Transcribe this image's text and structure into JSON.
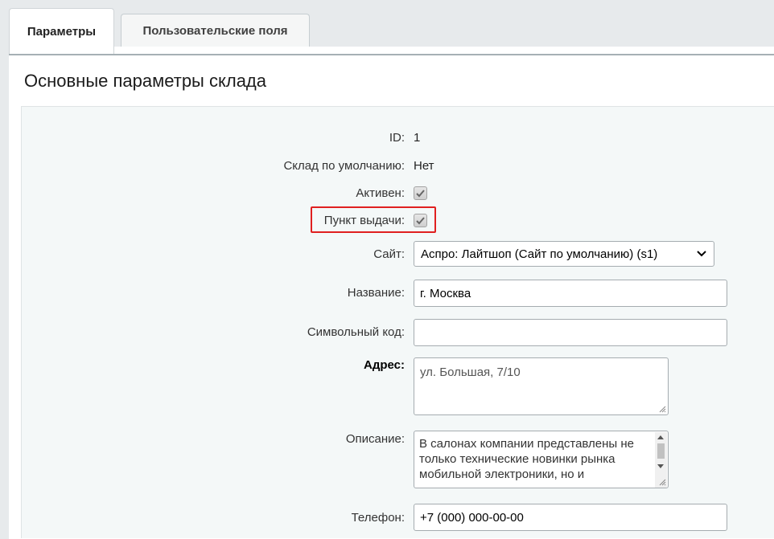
{
  "tabs": [
    {
      "label": "Параметры",
      "active": true
    },
    {
      "label": "Пользовательские поля",
      "active": false
    }
  ],
  "section_title": "Основные параметры склада",
  "fields": {
    "id": {
      "label": "ID:",
      "value": "1"
    },
    "default_store": {
      "label": "Склад по умолчанию:",
      "value": "Нет"
    },
    "active": {
      "label": "Активен:",
      "checked": true
    },
    "pickup_point": {
      "label": "Пункт выдачи:",
      "checked": true
    },
    "site": {
      "label": "Сайт:",
      "selected": "Аспро: Лайтшоп (Сайт по умолчанию) (s1)"
    },
    "name": {
      "label": "Название:",
      "value": "г. Москва"
    },
    "code": {
      "label": "Символьный код:",
      "value": ""
    },
    "address": {
      "label": "Адрес:",
      "value": "ул. Большая, 7/10"
    },
    "description": {
      "label": "Описание:",
      "value": "В салонах компании представлены не только технические новинки рынка мобильной электроники, но и"
    },
    "phone": {
      "label": "Телефон:",
      "value": "+7 (000) 000-00-00"
    }
  },
  "colors": {
    "highlight": "#e02020",
    "form_bg": "#f4f8f8"
  }
}
